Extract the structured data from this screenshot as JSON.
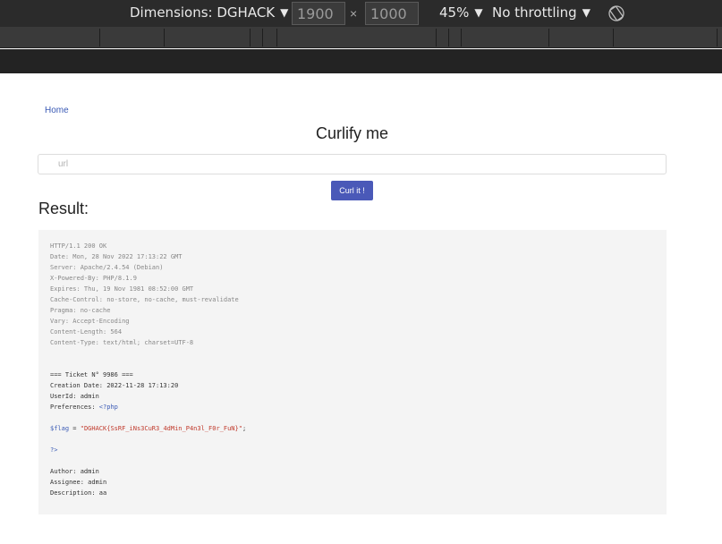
{
  "devtools": {
    "dimensions_label": "Dimensions: DGHACK",
    "width": "1900",
    "height": "1000",
    "times": "×",
    "zoom": "45%",
    "throttling": "No throttling"
  },
  "page": {
    "breadcrumb": "Home",
    "title": "Curlify me",
    "url_placeholder": "url",
    "curl_button": "Curl it !",
    "result_heading": "Result:"
  },
  "result": {
    "headers": [
      "HTTP/1.1 200 OK",
      "Date: Mon, 28 Nov 2022 17:13:22 GMT",
      "Server: Apache/2.4.54 (Debian)",
      "X-Powered-By: PHP/8.1.9",
      "Expires: Thu, 19 Nov 1981 08:52:00 GMT",
      "Cache-Control: no-store, no-cache, must-revalidate",
      "Pragma: no-cache",
      "Vary: Accept-Encoding",
      "Content-Length: 564",
      "Content-Type: text/html; charset=UTF-8"
    ],
    "ticket_header": "=== Ticket N° 9986 ===",
    "creation_date": "Creation Date: 2022-11-28 17:13:20",
    "user_id": "UserId: admin",
    "preferences_label": "Preferences: ",
    "php_open": "<?php",
    "flag_var": "$flag",
    "flag_eq": " = ",
    "flag_value": "\"DGHACK{SsRF_iNs3CuR3_4dMin_P4n3l_F0r_FuN}\"",
    "flag_end": ";",
    "php_close": "?>",
    "author": "Author: admin",
    "assignee": "Assignee: admin",
    "description": "Description: aa"
  }
}
